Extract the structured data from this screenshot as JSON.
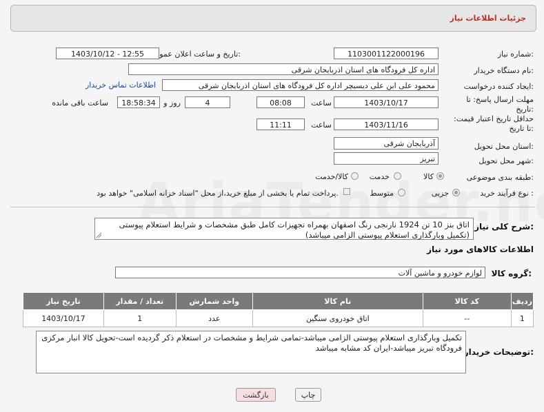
{
  "header": {
    "title": "جزئیات اطلاعات نیاز"
  },
  "fields": {
    "need_number": {
      "label": "شماره نیاز:",
      "value": "1103001122000196"
    },
    "announce_datetime": {
      "label": "تاریخ و ساعت اعلان عمومی:",
      "value": "1403/10/12 - 12:55"
    },
    "buyer_org": {
      "label": "نام دستگاه خریدار:",
      "value": "اداره کل فرودگاه های استان اذربایجان شرقی"
    },
    "requester": {
      "label": "ایجاد کننده درخواست:",
      "value": "محمود علی ابن علی دیسیچر اداره کل فرودگاه های استان اذربایجان شرقی",
      "contact_link": "اطلاعات تماس خریدار"
    },
    "reply_deadline": {
      "label": "مهلت ارسال پاسخ: تا تاریخ:",
      "date": "1403/10/17",
      "time_label": "ساعت",
      "time": "08:08",
      "days": "4",
      "days_label": "روز و",
      "remaining": "18:58:34",
      "remaining_label": "ساعت باقی مانده"
    },
    "price_validity": {
      "label": "حداقل تاریخ اعتبار قیمت: تا تاریخ:",
      "date": "1403/11/16",
      "time_label": "ساعت",
      "time": "11:11"
    },
    "delivery_province": {
      "label": "استان محل تحویل:",
      "value": "آذربایجان شرقی"
    },
    "delivery_city": {
      "label": "شهر محل تحویل:",
      "value": "تبریز"
    },
    "category": {
      "label": "طبقه بندی موضوعی:",
      "options": [
        "کالا",
        "خدمت",
        "کالا/خدمت"
      ]
    },
    "process_type": {
      "label": "نوع فرآیند خرید :",
      "options": [
        "جزیی",
        "متوسط"
      ],
      "payment_note": "پرداخت تمام یا بخشی از مبلغ خرید،از محل \"اسناد خزانه اسلامی\" خواهد بود."
    }
  },
  "description": {
    "label": "شرح کلی نیاز:",
    "text": "اتاق بنز 10 تن 1924 نارنجی رنگ اصفهان بهمراه تجهیزات کامل طبق مشخصات و شرایط استعلام پیوستی (تکمیل وبارگذاری استعلام پیوستی الزامی میباشد)"
  },
  "goods_section": {
    "title": "اطلاعات کالاهای مورد نیاز",
    "group_label": "گروه کالا:",
    "group_value": "لوازم خودرو و ماشین آلات"
  },
  "table": {
    "headers": [
      "ردیف",
      "کد کالا",
      "نام کالا",
      "واحد شمارش",
      "تعداد / مقدار",
      "تاریخ نیاز"
    ],
    "rows": [
      [
        "1",
        "--",
        "اتاق خودروی سنگین",
        "عدد",
        "1",
        "1403/10/17"
      ]
    ]
  },
  "buyer_notes": {
    "label": "توضیحات خریدار:",
    "text": "تکمیل وبارگذاری استعلام پیوستی الزامی میباشد-تمامی شرایط و مشخصات در استعلام ذکر گردیده است-تحویل کالا انبار مرکزی فرودگاه تبریز میباشد-ایران کد مشابه میباشد"
  },
  "buttons": {
    "print": "چاپ",
    "back": "بازگشت"
  },
  "watermark": "AriaTender.neT",
  "colors": {
    "header_title": "#b7321e",
    "link": "#1a48a8",
    "back_button_bg": "#f6dede"
  }
}
